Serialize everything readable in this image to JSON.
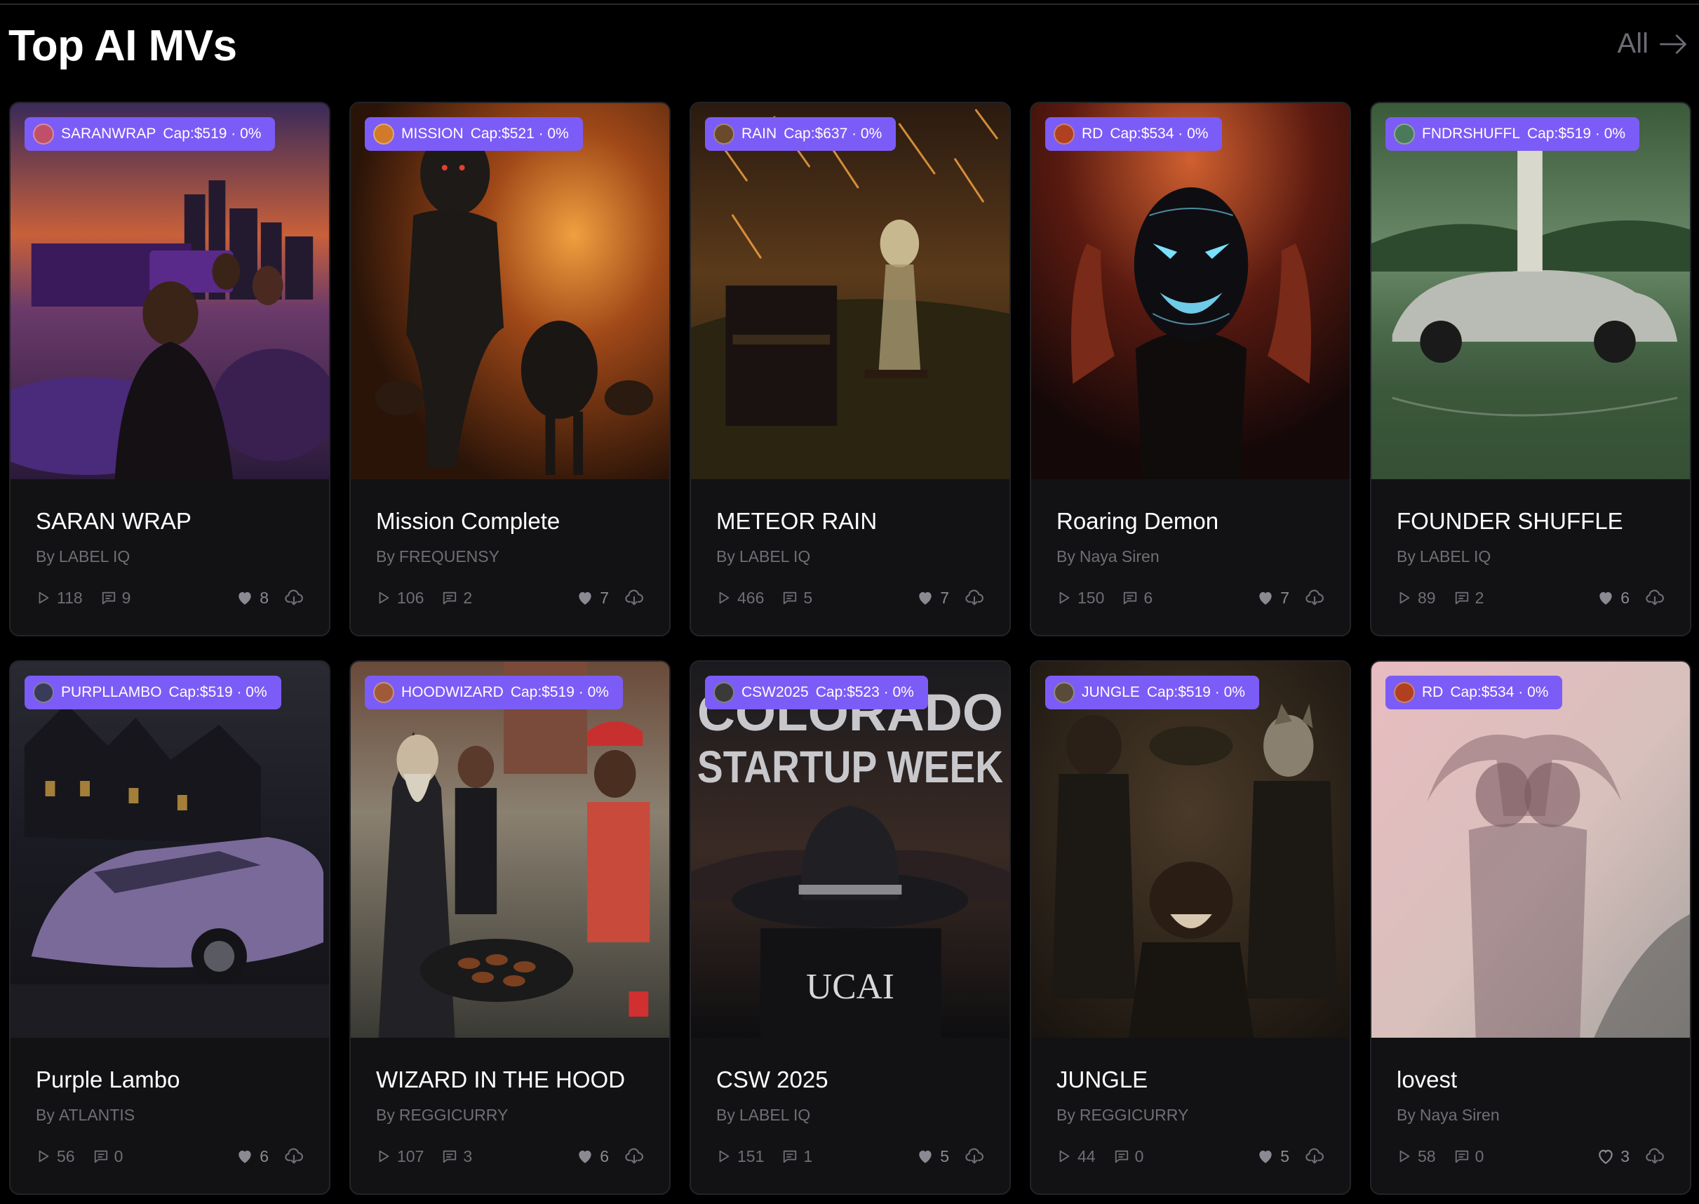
{
  "section": {
    "title": "Top AI MVs",
    "see_all_label": "All"
  },
  "cards": [
    {
      "ticker": "SARANWRAP",
      "cap": "Cap:$519 · 0%",
      "title": "SARAN WRAP",
      "by": "By",
      "artist": "LABEL IQ",
      "plays": "118",
      "comments": "9",
      "likes": "8",
      "liked": true,
      "art": "sunset-city",
      "avatar": "#c0506a"
    },
    {
      "ticker": "MISSION",
      "cap": "Cap:$521 · 0%",
      "title": "Mission Complete",
      "by": "By",
      "artist": "FREQUENSY",
      "plays": "106",
      "comments": "2",
      "likes": "7",
      "liked": true,
      "art": "fire",
      "avatar": "#d07a2a"
    },
    {
      "ticker": "RAIN",
      "cap": "Cap:$637 · 0%",
      "title": "METEOR RAIN",
      "by": "By",
      "artist": "LABEL IQ",
      "plays": "466",
      "comments": "5",
      "likes": "7",
      "liked": true,
      "art": "meteor",
      "avatar": "#6a4a2a"
    },
    {
      "ticker": "RD",
      "cap": "Cap:$534 · 0%",
      "title": "Roaring Demon",
      "by": "By",
      "artist": "Naya Siren",
      "plays": "150",
      "comments": "6",
      "likes": "7",
      "liked": true,
      "art": "demon",
      "avatar": "#b04020"
    },
    {
      "ticker": "FNDRSHUFFL",
      "cap": "Cap:$519 · 0%",
      "title": "FOUNDER SHUFFLE",
      "by": "By",
      "artist": "LABEL IQ",
      "plays": "89",
      "comments": "2",
      "likes": "6",
      "liked": true,
      "art": "lake",
      "avatar": "#4a7a5a"
    },
    {
      "ticker": "PURPLLAMBO",
      "cap": "Cap:$519 · 0%",
      "title": "Purple Lambo",
      "by": "By",
      "artist": "ATLANTIS",
      "plays": "56",
      "comments": "0",
      "likes": "6",
      "liked": true,
      "art": "mansion",
      "avatar": "#3a3a5a"
    },
    {
      "ticker": "HOODWIZARD",
      "cap": "Cap:$519 · 0%",
      "title": "WIZARD IN THE HOOD",
      "by": "By",
      "artist": "REGGICURRY",
      "plays": "107",
      "comments": "3",
      "likes": "6",
      "liked": true,
      "art": "street",
      "avatar": "#a05a3a"
    },
    {
      "ticker": "CSW2025",
      "cap": "Cap:$523 · 0%",
      "title": "CSW 2025",
      "by": "By",
      "artist": "LABEL IQ",
      "plays": "151",
      "comments": "1",
      "likes": "5",
      "liked": true,
      "art": "poster",
      "avatar": "#3a3a3a",
      "poster_line1": "COLORADO",
      "poster_line2": "STARTUP WEEK",
      "poster_brand": "UCAI"
    },
    {
      "ticker": "JUNGLE",
      "cap": "Cap:$519 · 0%",
      "title": "JUNGLE",
      "by": "By",
      "artist": "REGGICURRY",
      "plays": "44",
      "comments": "0",
      "likes": "5",
      "liked": true,
      "art": "band",
      "avatar": "#5a4a3a"
    },
    {
      "ticker": "RD",
      "cap": "Cap:$534 · 0%",
      "title": "lovest",
      "by": "By",
      "artist": "Naya Siren",
      "plays": "58",
      "comments": "0",
      "likes": "3",
      "liked": false,
      "art": "shadow",
      "avatar": "#b04020"
    }
  ]
}
